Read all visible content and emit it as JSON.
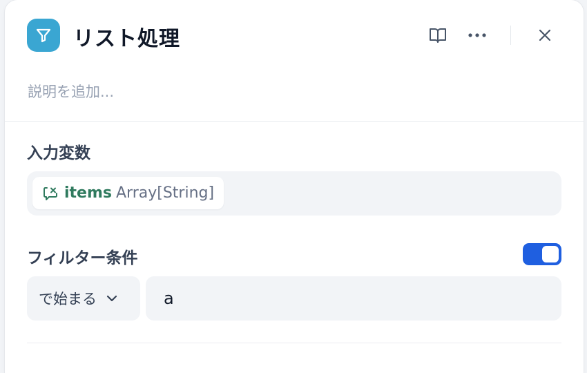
{
  "header": {
    "title": "リスト処理",
    "node_icon": "filter-icon",
    "icon_color": "#3aa6d2",
    "actions": [
      {
        "name": "book-icon"
      },
      {
        "name": "more-horizontal-icon"
      },
      {
        "name": "close-icon"
      }
    ]
  },
  "description": {
    "placeholder": "説明を追加..."
  },
  "input_variable": {
    "label": "入力変数",
    "icon": "variable-icon",
    "name": "items",
    "type": "Array[String]",
    "name_color": "#2f7a5e"
  },
  "filter": {
    "label": "フィルター条件",
    "enabled": true,
    "toggle_color": "#1f5fe0",
    "operator": "で始まる",
    "value": "a"
  }
}
